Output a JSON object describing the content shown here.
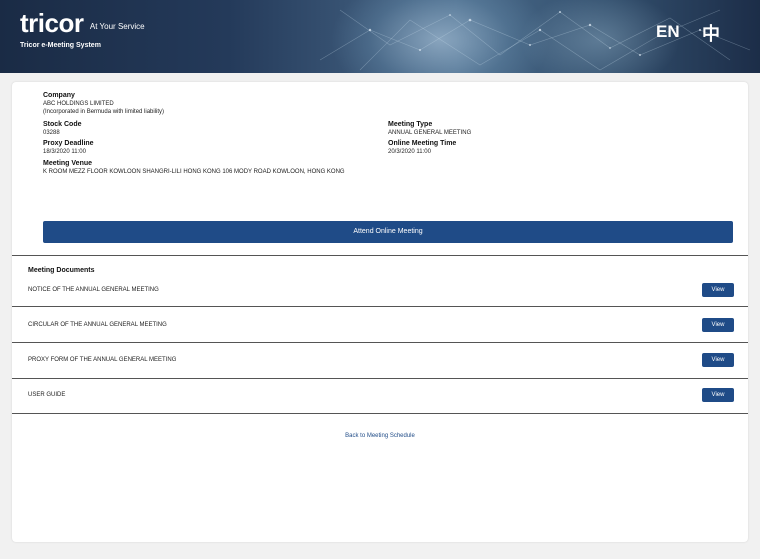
{
  "header": {
    "logo": "tricor",
    "tagline": "At Your Service",
    "system_name": "Tricor e-Meeting System",
    "lang_en": "EN",
    "lang_zh": "中"
  },
  "meeting": {
    "company_label": "Company",
    "company_name": "ABC HOLDINGS LIMITED",
    "company_note": "(Incorporated in Bermuda with limited liability)",
    "stock_code_label": "Stock Code",
    "stock_code": "03288",
    "meeting_type_label": "Meeting Type",
    "meeting_type": "ANNUAL GENERAL MEETING",
    "proxy_deadline_label": "Proxy Deadline",
    "proxy_deadline": "18/3/2020 11:00",
    "online_time_label": "Online Meeting Time",
    "online_time": "20/3/2020 11:00",
    "venue_label": "Meeting Venue",
    "venue": "K ROOM MEZZ FLOOR KOWLOON SHANGRI-LILI HONG KONG 106 MODY ROAD KOWLOON, HONG KONG",
    "attend_button": "Attend Online Meeting"
  },
  "documents": {
    "heading": "Meeting Documents",
    "view_label": "View",
    "items": [
      {
        "title": "NOTICE OF THE ANNUAL GENERAL MEETING"
      },
      {
        "title": "CIRCULAR OF THE ANNUAL GENERAL MEETING"
      },
      {
        "title": "PROXY FORM OF THE ANNUAL GENERAL MEETING"
      },
      {
        "title": "USER GUIDE"
      }
    ]
  },
  "back_link": "Back to Meeting Schedule"
}
